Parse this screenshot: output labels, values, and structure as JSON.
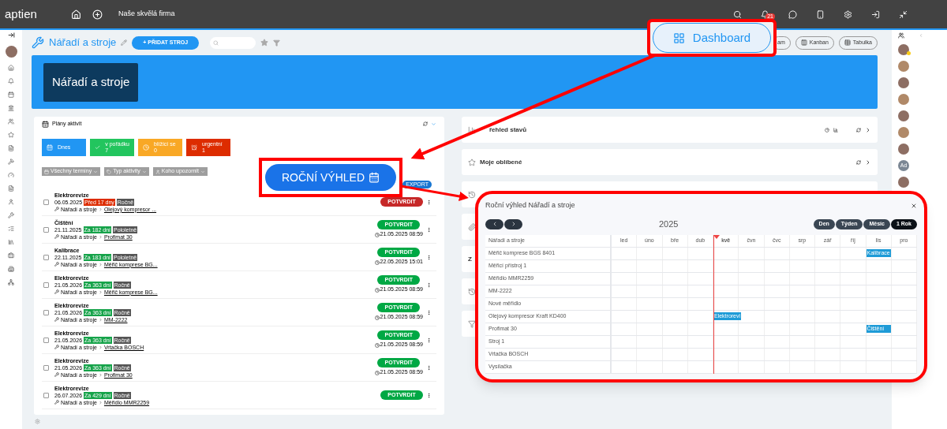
{
  "topbar": {
    "logo": "aptien",
    "company": "Naše skvělá firma",
    "notification_count": "21"
  },
  "header": {
    "title": "Nářadí a stroje",
    "add_button": "+ PŘIDAT STROJ",
    "view_buttons": [
      {
        "kind": "plain",
        "label": "am"
      },
      {
        "kind": "kanban",
        "label": "Kanban"
      },
      {
        "kind": "table",
        "label": "Tabulka"
      }
    ]
  },
  "banner": {
    "title": "Nářadí a stroje"
  },
  "activities": {
    "title": "Plány aktivit",
    "tiles": [
      {
        "kind": "today",
        "label": "Dnes"
      },
      {
        "kind": "ok",
        "label": "v pořádku",
        "count": "7"
      },
      {
        "kind": "soon",
        "label": "blížící se",
        "count": "0"
      },
      {
        "kind": "urgent",
        "label": "urgentní",
        "count": "1"
      }
    ],
    "filters": [
      {
        "kind": "calendar",
        "label": "Všechny termíny"
      },
      {
        "kind": "type",
        "label": "Typ aktivity"
      },
      {
        "kind": "person",
        "label": "Koho upozornit"
      }
    ],
    "export": "EXPORT",
    "rows": [
      {
        "title": "Elektrorevize",
        "date": "06.05.2025",
        "due": "Před 17 dny",
        "overdue": true,
        "frequency": "Ročně",
        "path": "Nářadí a stroje",
        "item": "Olejový kompresor ...",
        "action": "POTVRDIT",
        "checked": false
      },
      {
        "title": "Čištění",
        "date": "21.11.2025",
        "due": "Za 182 dní",
        "overdue": false,
        "frequency": "Pololetně",
        "path": "Nářadí a stroje",
        "item": "Profimat 30",
        "action": "POTVRDIT",
        "confirmed": "21.05.2025 08:59",
        "checked": false
      },
      {
        "title": "Kalibrace",
        "date": "22.11.2025",
        "due": "Za 183 dní",
        "overdue": false,
        "frequency": "Pololetně",
        "path": "Nářadí a stroje",
        "item": "Měřič komprese BG...",
        "action": "POTVRDIT",
        "confirmed": "22.05.2025 15:01",
        "checked": false
      },
      {
        "title": "Elektrorevize",
        "date": "21.05.2026",
        "due": "Za 363 dní",
        "overdue": false,
        "frequency": "Ročně",
        "path": "Nářadí a stroje",
        "item": "Měřič komprese BG...",
        "action": "POTVRDIT",
        "confirmed": "21.05.2025 08:59",
        "checked": false
      },
      {
        "title": "Elektrorevize",
        "date": "21.05.2026",
        "due": "Za 363 dní",
        "overdue": false,
        "frequency": "Ročně",
        "path": "Nářadí a stroje",
        "item": "MM-2222",
        "action": "POTVRDIT",
        "confirmed": "21.05.2025 08:59",
        "checked": false
      },
      {
        "title": "Elektrorevize",
        "date": "21.05.2026",
        "due": "Za 363 dní",
        "overdue": false,
        "frequency": "Ročně",
        "path": "Nářadí a stroje",
        "item": "Vrtačka BOSCH",
        "action": "POTVRDIT",
        "confirmed": "21.05.2025 08:59",
        "checked": false
      },
      {
        "title": "Elektrorevize",
        "date": "21.05.2026",
        "due": "Za 363 dní",
        "overdue": false,
        "frequency": "Ročně",
        "path": "Nářadí a stroje",
        "item": "Profimat 30",
        "action": "POTVRDIT",
        "confirmed": "21.05.2025 08:59",
        "checked": false
      },
      {
        "title": "Elektrorevize",
        "date": "26.07.2026",
        "due": "Za 429 dní",
        "overdue": false,
        "frequency": "Ročně",
        "path": "Nářadí a stroje",
        "item": "Měřidlo MMR2259",
        "action": "POTVRDIT",
        "checked": false
      }
    ]
  },
  "cards": [
    {
      "kind": "status",
      "title": "řehled stavů"
    },
    {
      "kind": "favorites",
      "title": "Moje oblíbené"
    },
    {
      "kind": "history"
    },
    {
      "kind": "attachments"
    },
    {
      "kind": "letter",
      "title": "Z"
    },
    {
      "kind": "history"
    },
    {
      "kind": "filter"
    }
  ],
  "avatars": [
    {
      "kind": "photo"
    },
    {
      "kind": "photo"
    },
    {
      "kind": "photo"
    },
    {
      "kind": "photo"
    },
    {
      "kind": "photo"
    },
    {
      "kind": "photo"
    },
    {
      "kind": "photo"
    },
    {
      "kind": "initials",
      "text": "Ad"
    },
    {
      "kind": "photo"
    }
  ],
  "callouts": {
    "dashboard": "Dashboard",
    "year_view": "ROČNÍ VÝHLED"
  },
  "dialog": {
    "title": "Roční výhled Nářadí a stroje",
    "year": "2025",
    "views": [
      {
        "label": "Den",
        "selected": false
      },
      {
        "label": "Týden",
        "selected": false
      },
      {
        "label": "Měsíc",
        "selected": false
      },
      {
        "label": "1 Rok",
        "selected": true
      }
    ],
    "column_header": "Nářadí a stroje",
    "months": [
      {
        "label": "led",
        "current": false
      },
      {
        "label": "úno",
        "current": false
      },
      {
        "label": "bře",
        "current": false
      },
      {
        "label": "dub",
        "current": false
      },
      {
        "label": "kvě",
        "current": true
      },
      {
        "label": "čvn",
        "current": false
      },
      {
        "label": "čvc",
        "current": false
      },
      {
        "label": "srp",
        "current": false
      },
      {
        "label": "zář",
        "current": false
      },
      {
        "label": "říj",
        "current": false
      },
      {
        "label": "lis",
        "current": false
      },
      {
        "label": "pro",
        "current": false
      }
    ],
    "rows": [
      {
        "name": "Měřič komprese BGS 8401",
        "cells": [
          {},
          {},
          {},
          {},
          {},
          {},
          {},
          {},
          {},
          {},
          {
            "event": "Kalibrace"
          },
          {}
        ]
      },
      {
        "name": "Měřicí přístroj 1"
      },
      {
        "name": "Měřidlo MMR2259"
      },
      {
        "name": "MM-2222"
      },
      {
        "name": "Nové měřidlo"
      },
      {
        "name": "Olejový kompresor Kraft KD400",
        "cells": [
          {},
          {},
          {},
          {},
          {
            "event": "Elektrorevi"
          },
          {},
          {},
          {},
          {},
          {},
          {},
          {}
        ]
      },
      {
        "name": "Profimat 30",
        "cells": [
          {},
          {},
          {},
          {},
          {},
          {},
          {},
          {},
          {},
          {},
          {
            "event": "Čištění"
          },
          {}
        ]
      },
      {
        "name": "Stroj 1"
      },
      {
        "name": "Vrtačka BOSCH"
      },
      {
        "name": "Vysílačka"
      }
    ]
  }
}
